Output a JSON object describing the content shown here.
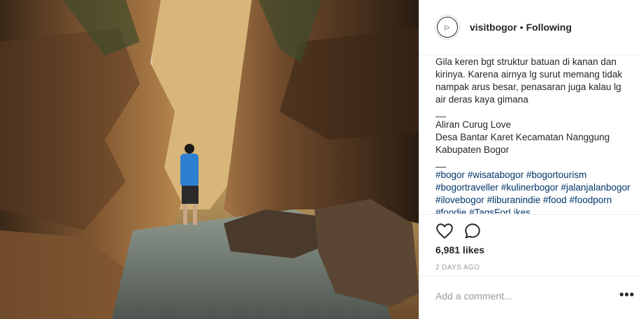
{
  "post": {
    "username": "visitbogor",
    "separator": "•",
    "follow_state": "Following",
    "avatar_text": "▷"
  },
  "caption": {
    "body": "Gila keren bgt struktur batuan di kanan dan kirinya. Karena airnya lg surut memang tidak nampak arus besar, penasaran juga kalau lg air deras kaya gimana",
    "dash1": "__",
    "location_line1": "Aliran Curug Love",
    "location_line2": "Desa Bantar Karet Kecamatan Nanggung",
    "location_line3": "Kabupaten Bogor",
    "dash2": "__",
    "tags": [
      "#bogor",
      "#wisatabogor",
      "#bogortourism",
      "#bogortraveller",
      "#kulinerbogor",
      "#jalanjalanbogor",
      "#ilovebogor",
      "#liburanindie",
      "#food",
      "#foodporn",
      "#foodie",
      "#TagsForLikes"
    ]
  },
  "actions": {
    "like_icon": "heart-icon",
    "comment_icon": "comment-bubble-icon"
  },
  "likes": "6,981 likes",
  "timestamp": "2 DAYS AGO",
  "comment_placeholder": "Add a comment...",
  "more_label": "•••"
}
